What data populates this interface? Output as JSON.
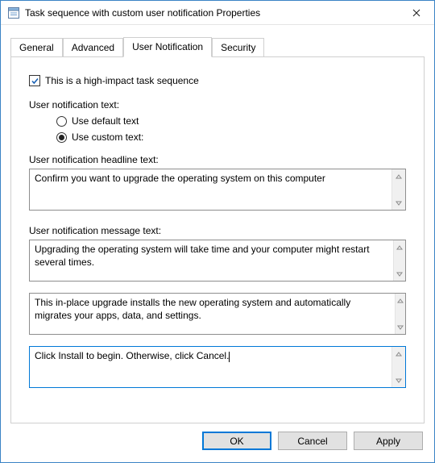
{
  "window": {
    "title": "Task sequence with custom user notification Properties"
  },
  "tabs": {
    "general": "General",
    "advanced": "Advanced",
    "user_notification": "User Notification",
    "security": "Security"
  },
  "panel": {
    "high_impact_label": "This is a high-impact task sequence",
    "notification_text_label": "User notification text:",
    "radio_default": "Use default text",
    "radio_custom": "Use custom text:",
    "headline_label": "User notification headline text:",
    "headline_value": "Confirm you want to upgrade the operating system on this computer",
    "message_label": "User notification message text:",
    "message1": "Upgrading the operating system will take time and your computer might restart several times.",
    "message2": "This in-place upgrade installs the new operating system and automatically migrates your apps, data, and settings.",
    "message3": "Click Install to begin. Otherwise, click Cancel."
  },
  "buttons": {
    "ok": "OK",
    "cancel": "Cancel",
    "apply": "Apply"
  }
}
